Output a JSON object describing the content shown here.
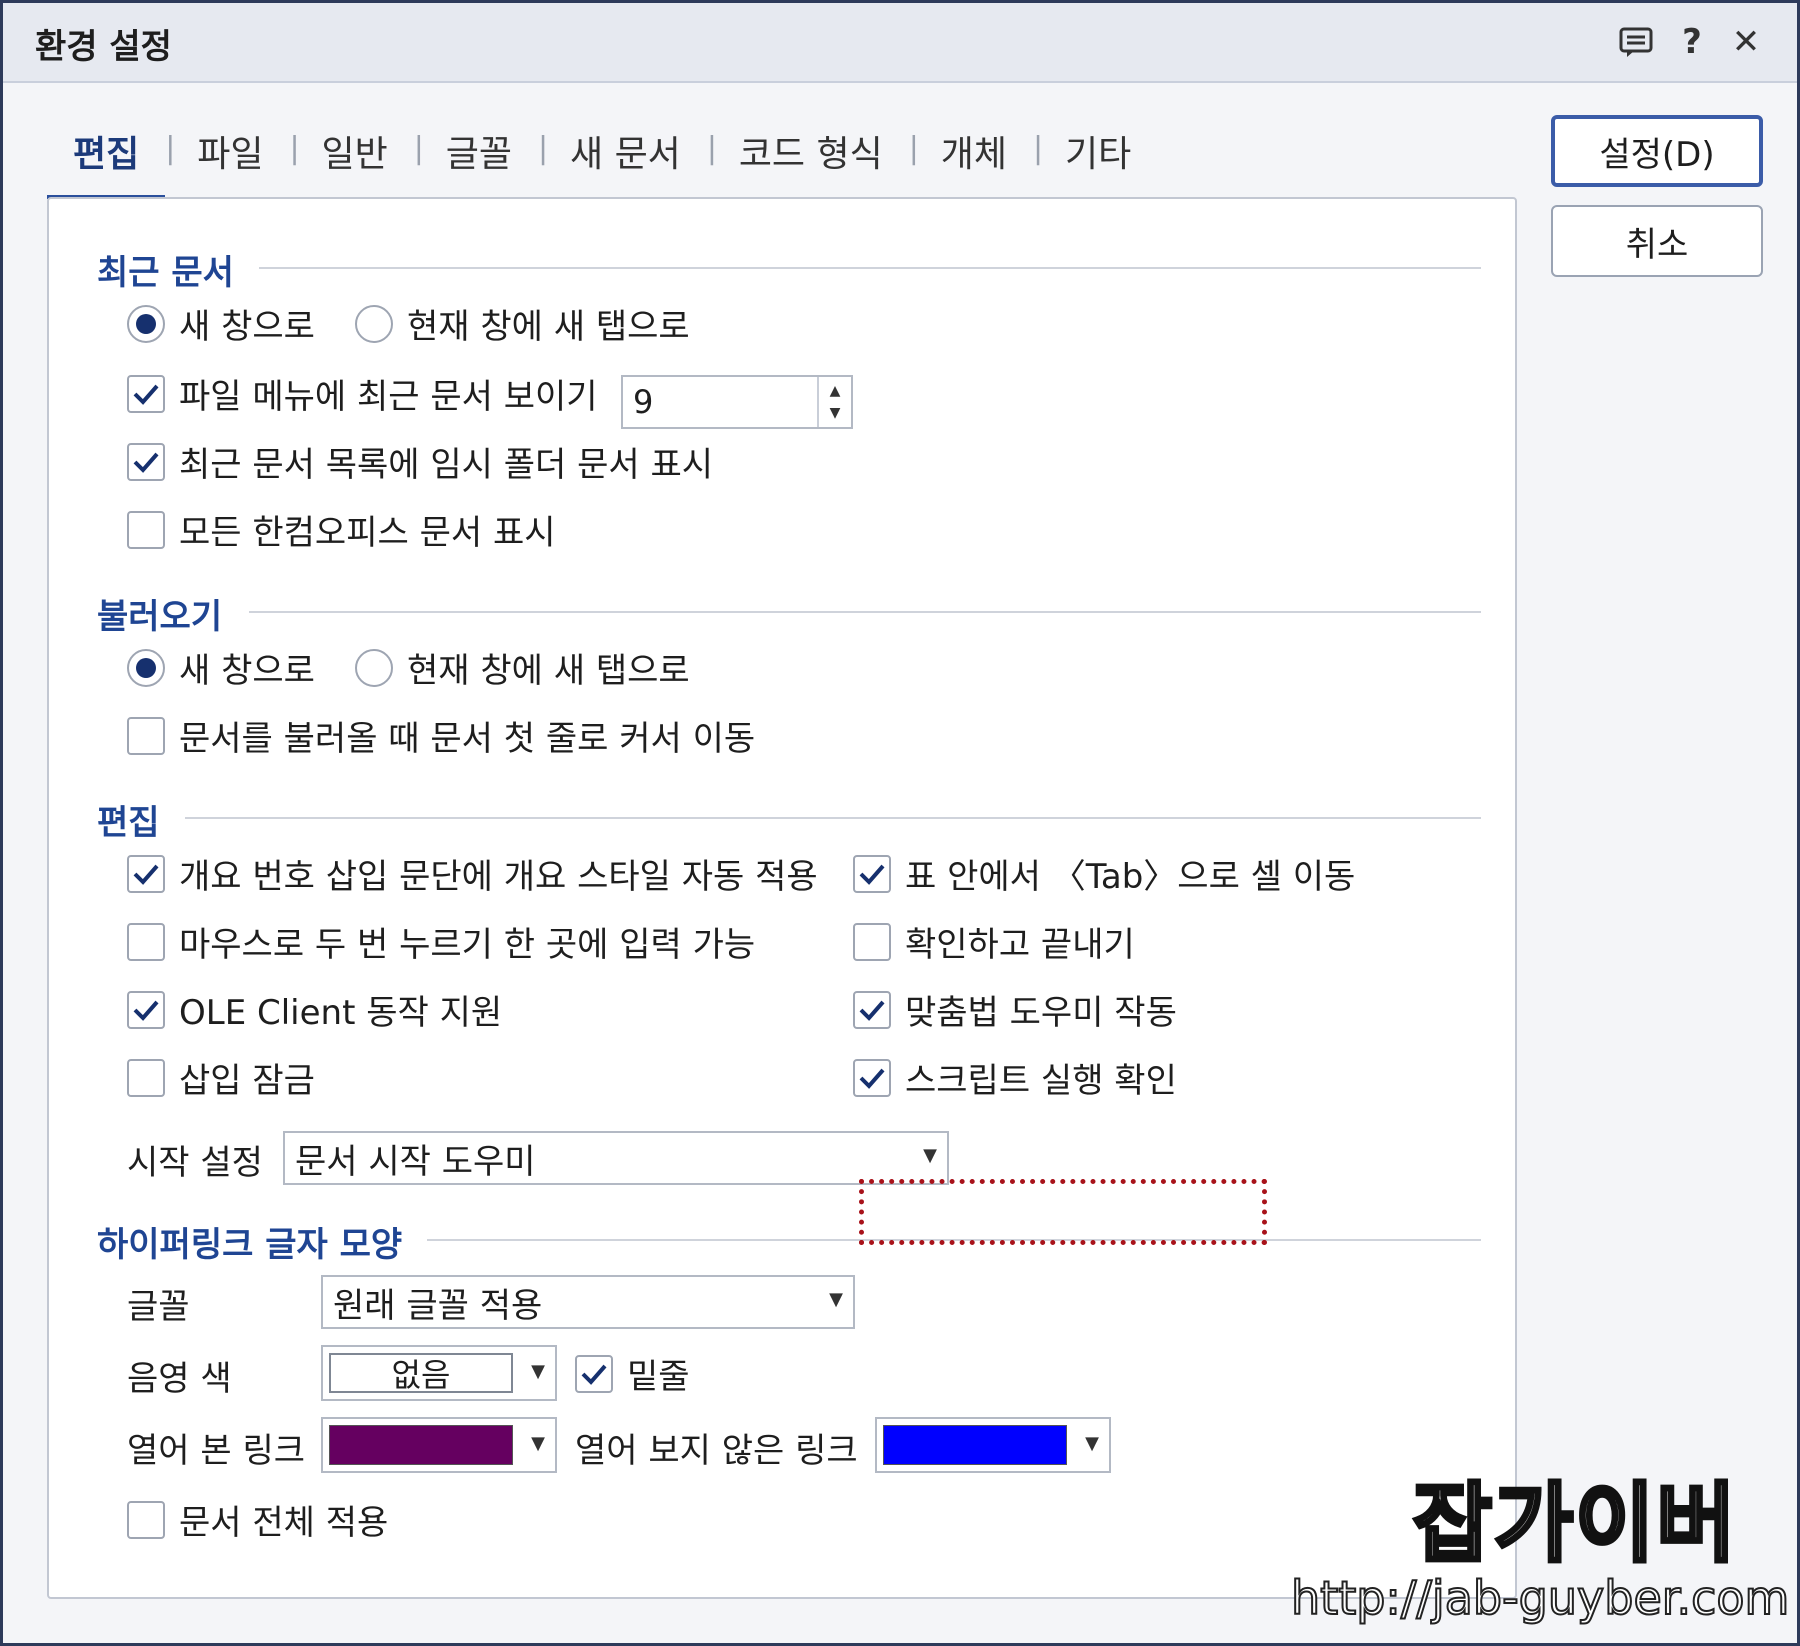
{
  "window": {
    "title": "환경 설정",
    "title_icons": [
      "comment-icon",
      "help-icon",
      "close-icon"
    ],
    "help_glyph": "?",
    "close_glyph": "✕"
  },
  "tabs": [
    {
      "label": "편집",
      "active": true
    },
    {
      "label": "파일",
      "active": false
    },
    {
      "label": "일반",
      "active": false
    },
    {
      "label": "글꼴",
      "active": false
    },
    {
      "label": "새 문서",
      "active": false
    },
    {
      "label": "코드 형식",
      "active": false
    },
    {
      "label": "개체",
      "active": false
    },
    {
      "label": "기타",
      "active": false
    }
  ],
  "buttons": {
    "ok": "설정(D)",
    "cancel": "취소"
  },
  "recent": {
    "title": "최근 문서",
    "radio_new_window": "새 창으로",
    "radio_new_tab": "현재 창에 새 탭으로",
    "selected": "new_window",
    "show_in_file_menu": {
      "label": "파일 메뉴에 최근 문서 보이기",
      "checked": true,
      "value": "9"
    },
    "show_temp_folder": {
      "label": "최근 문서 목록에 임시 폴더 문서 표시",
      "checked": true
    },
    "show_all_hancom": {
      "label": "모든 한컴오피스 문서 표시",
      "checked": false
    }
  },
  "load": {
    "title": "불러오기",
    "radio_new_window": "새 창으로",
    "radio_new_tab": "현재 창에 새 탭으로",
    "selected": "new_window",
    "cursor_first_line": {
      "label": "문서를 불러올 때 문서 첫 줄로 커서 이동",
      "checked": false
    }
  },
  "edit": {
    "title": "편집",
    "outline_style": {
      "label": "개요 번호 삽입 문단에 개요 스타일 자동 적용",
      "checked": true
    },
    "tab_cell_move": {
      "label": "표 안에서 〈Tab〉으로 셀 이동",
      "checked": true
    },
    "double_click_input": {
      "label": "마우스로 두 번 누르기 한 곳에 입력 가능",
      "checked": false
    },
    "confirm_exit": {
      "label": "확인하고 끝내기",
      "checked": false
    },
    "ole_client": {
      "label": "OLE Client 동작 지원",
      "checked": true
    },
    "spell_helper": {
      "label": "맞춤법 도우미 작동",
      "checked": true
    },
    "insert_lock": {
      "label": "삽입 잠금",
      "checked": false
    },
    "script_confirm": {
      "label": "스크립트 실행 확인",
      "checked": true
    },
    "start_setting_label": "시작 설정",
    "start_setting_value": "문서 시작 도우미"
  },
  "hyperlink": {
    "title": "하이퍼링크 글자 모양",
    "font_label": "글꼴",
    "font_value": "원래 글꼴 적용",
    "shade_label": "음영 색",
    "shade_value": "없음",
    "underline": {
      "label": "밑줄",
      "checked": true
    },
    "visited_label": "열어 본 링크",
    "visited_color": "#650060",
    "unvisited_label": "열어 보지 않은 링크",
    "unvisited_color": "#0000ff",
    "apply_all": {
      "label": "문서 전체 적용",
      "checked": false
    }
  },
  "watermark": {
    "title": "잡가이버",
    "url": "http://jab-guyber.com"
  },
  "colors": {
    "accent": "#1f4593",
    "highlight_border": "#a8121a",
    "check": "#16306e"
  }
}
